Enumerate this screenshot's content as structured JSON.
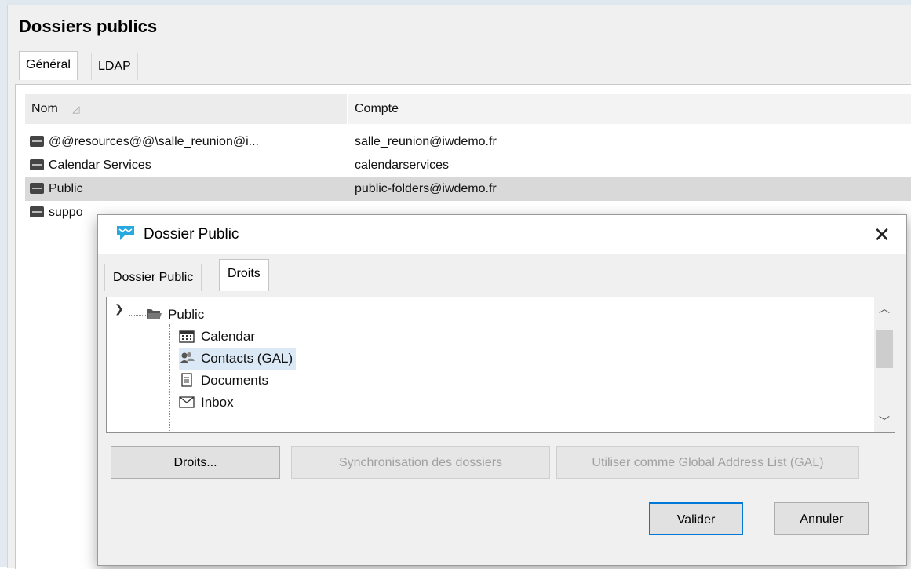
{
  "window": {
    "title": "Dossiers publics",
    "tabs": [
      {
        "label": "Général",
        "active": true
      },
      {
        "label": "LDAP",
        "active": false
      }
    ]
  },
  "list": {
    "columns": {
      "name": "Nom",
      "account": "Compte"
    },
    "rows": [
      {
        "name": "@@resources@@\\salle_reunion@i...",
        "account": "salle_reunion@iwdemo.fr",
        "selected": false
      },
      {
        "name": "Calendar Services",
        "account": "calendarservices",
        "selected": false
      },
      {
        "name": "Public",
        "account": "public-folders@iwdemo.fr",
        "selected": true
      },
      {
        "name": "suppo",
        "account": "",
        "selected": false
      }
    ]
  },
  "dialog": {
    "title": "Dossier Public",
    "close_glyph": "✕",
    "tabs": [
      {
        "label": "Dossier Public",
        "active": false
      },
      {
        "label": "Droits",
        "active": true
      }
    ],
    "tree": {
      "root": {
        "label": "Public",
        "icon": "folder-open-icon",
        "expanded": true
      },
      "children": [
        {
          "label": "Calendar",
          "icon": "calendar-icon",
          "selected": false
        },
        {
          "label": "Contacts (GAL)",
          "icon": "contacts-icon",
          "selected": true
        },
        {
          "label": "Documents",
          "icon": "document-icon",
          "selected": false
        },
        {
          "label": "Inbox",
          "icon": "mail-icon",
          "selected": false
        }
      ]
    },
    "buttons": {
      "rights": "Droits...",
      "sync": "Synchronisation des dossiers",
      "gal": "Utiliser comme Global Address List (GAL)",
      "ok": "Valider",
      "cancel": "Annuler"
    },
    "colors": {
      "accent": "#0078d7",
      "selection": "#dbe9f6"
    }
  }
}
